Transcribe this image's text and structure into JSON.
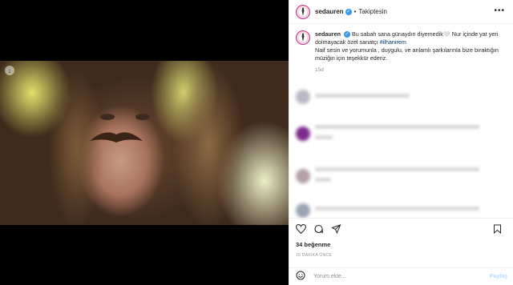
{
  "post": {
    "username": "sedauren",
    "verified_icon": "verified-badge-icon",
    "separator": "•",
    "follow_status": "Takiptesin",
    "more_icon": "more-options-icon",
    "caption_line1": "Bu sabah sana günaydın diyemedik🤍 Nur içinde yat yeri dolmayacak özel sanatçı ",
    "caption_hashtag": "#ilhanirem",
    "caption_line2": "Naif sesin ve yorumunla , duygulu, ve anlamlı şarkılarınla bize bıraktığın müziğin için teşekkür ederiz.",
    "age": "15d",
    "likes": "34 beğenme",
    "timestamp": "15 DAKİKA ÖNCE"
  },
  "comments": [
    {
      "name": "comment-1",
      "avatar_color": "#b9b9c6"
    },
    {
      "name": "comment-2",
      "avatar_color": "#7b2d8b"
    },
    {
      "name": "comment-3",
      "avatar_color": "#b69fa8"
    },
    {
      "name": "comment-4",
      "avatar_color": "#9aa3b4"
    }
  ],
  "composer": {
    "placeholder": "Yorum ekle...",
    "post_label": "Paylaş"
  },
  "colors": {
    "accent": "#3897f0",
    "link": "#00376b",
    "muted": "#8e8e8e",
    "post_disabled": "#b3dbff"
  }
}
